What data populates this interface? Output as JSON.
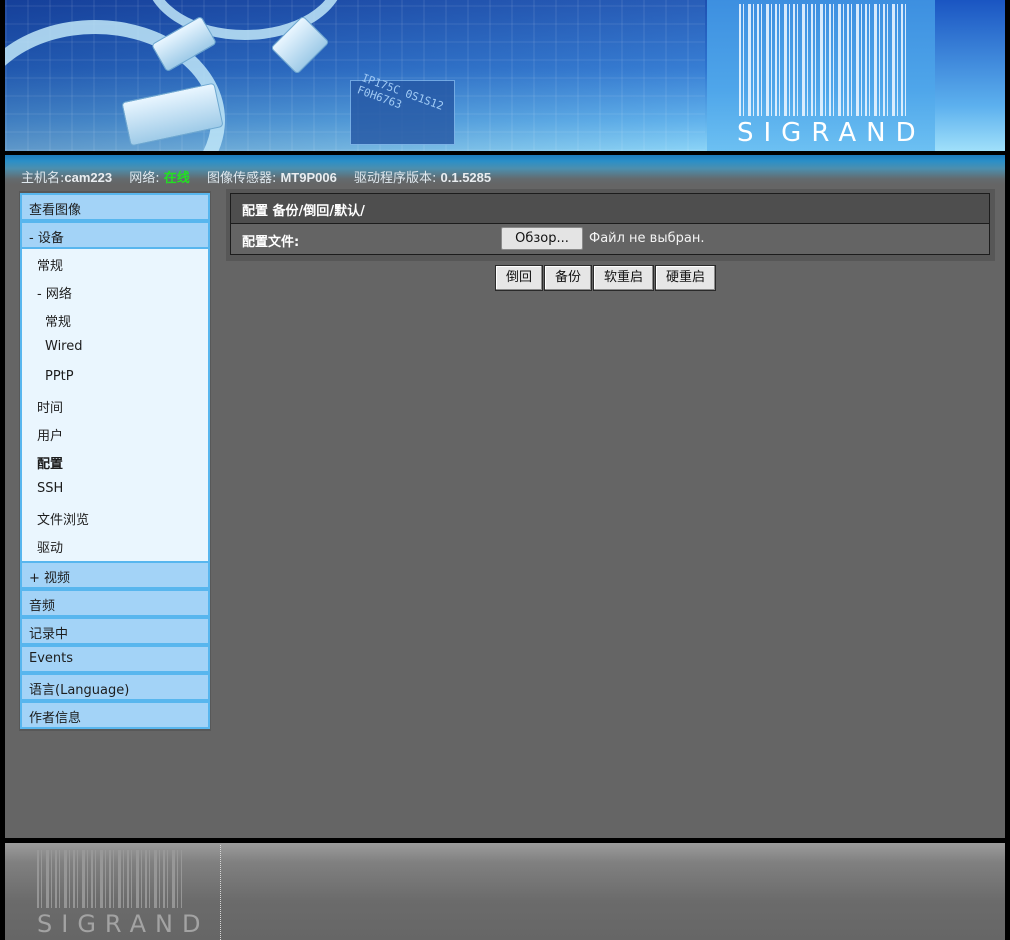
{
  "banner": {
    "logo_text": "SIGRAND",
    "chip_text": "IP175C 0S1S12 F0H6763"
  },
  "status": {
    "hostname_label": "主机名:",
    "hostname_value": "cam223",
    "network_label": "网络:",
    "network_value": "在线",
    "sensor_label": "图像传感器:",
    "sensor_value": "MT9P006",
    "driver_label": "驱动程序版本:",
    "driver_value": "0.1.5285",
    "colors": {
      "online": "#22e022"
    }
  },
  "sidebar": {
    "view_image": "查看图像",
    "device": "- 设备",
    "device_items": {
      "general": "常规",
      "network": "- 网络",
      "network_general": "常规",
      "network_wired": "Wired",
      "network_pptp": "PPtP",
      "time": "时间",
      "users": "用户",
      "config": "配置",
      "ssh": "SSH",
      "file_browser": "文件浏览",
      "driver": "驱动"
    },
    "video": "+ 视频",
    "audio": "音频",
    "recording": "记录中",
    "events": "Events",
    "language": "语言(Language)",
    "about": "作者信息",
    "colors": {
      "item_bg": "#a3d3f7",
      "item_border": "#58b6ee",
      "sub_bg": "#eaf6fe"
    }
  },
  "config": {
    "title_prefix": "配置 ",
    "crumb_backup": "备份",
    "crumb_restore": "倒回",
    "crumb_default": "默认",
    "sep": "/",
    "file_label": "配置文件:",
    "browse_label": "Обзор...",
    "file_status": "Файл не выбран."
  },
  "actions": {
    "restore": "倒回",
    "backup": "备份",
    "soft_reboot": "软重启",
    "hard_reboot": "硬重启"
  },
  "footer": {
    "logo_text": "SIGRAND"
  }
}
